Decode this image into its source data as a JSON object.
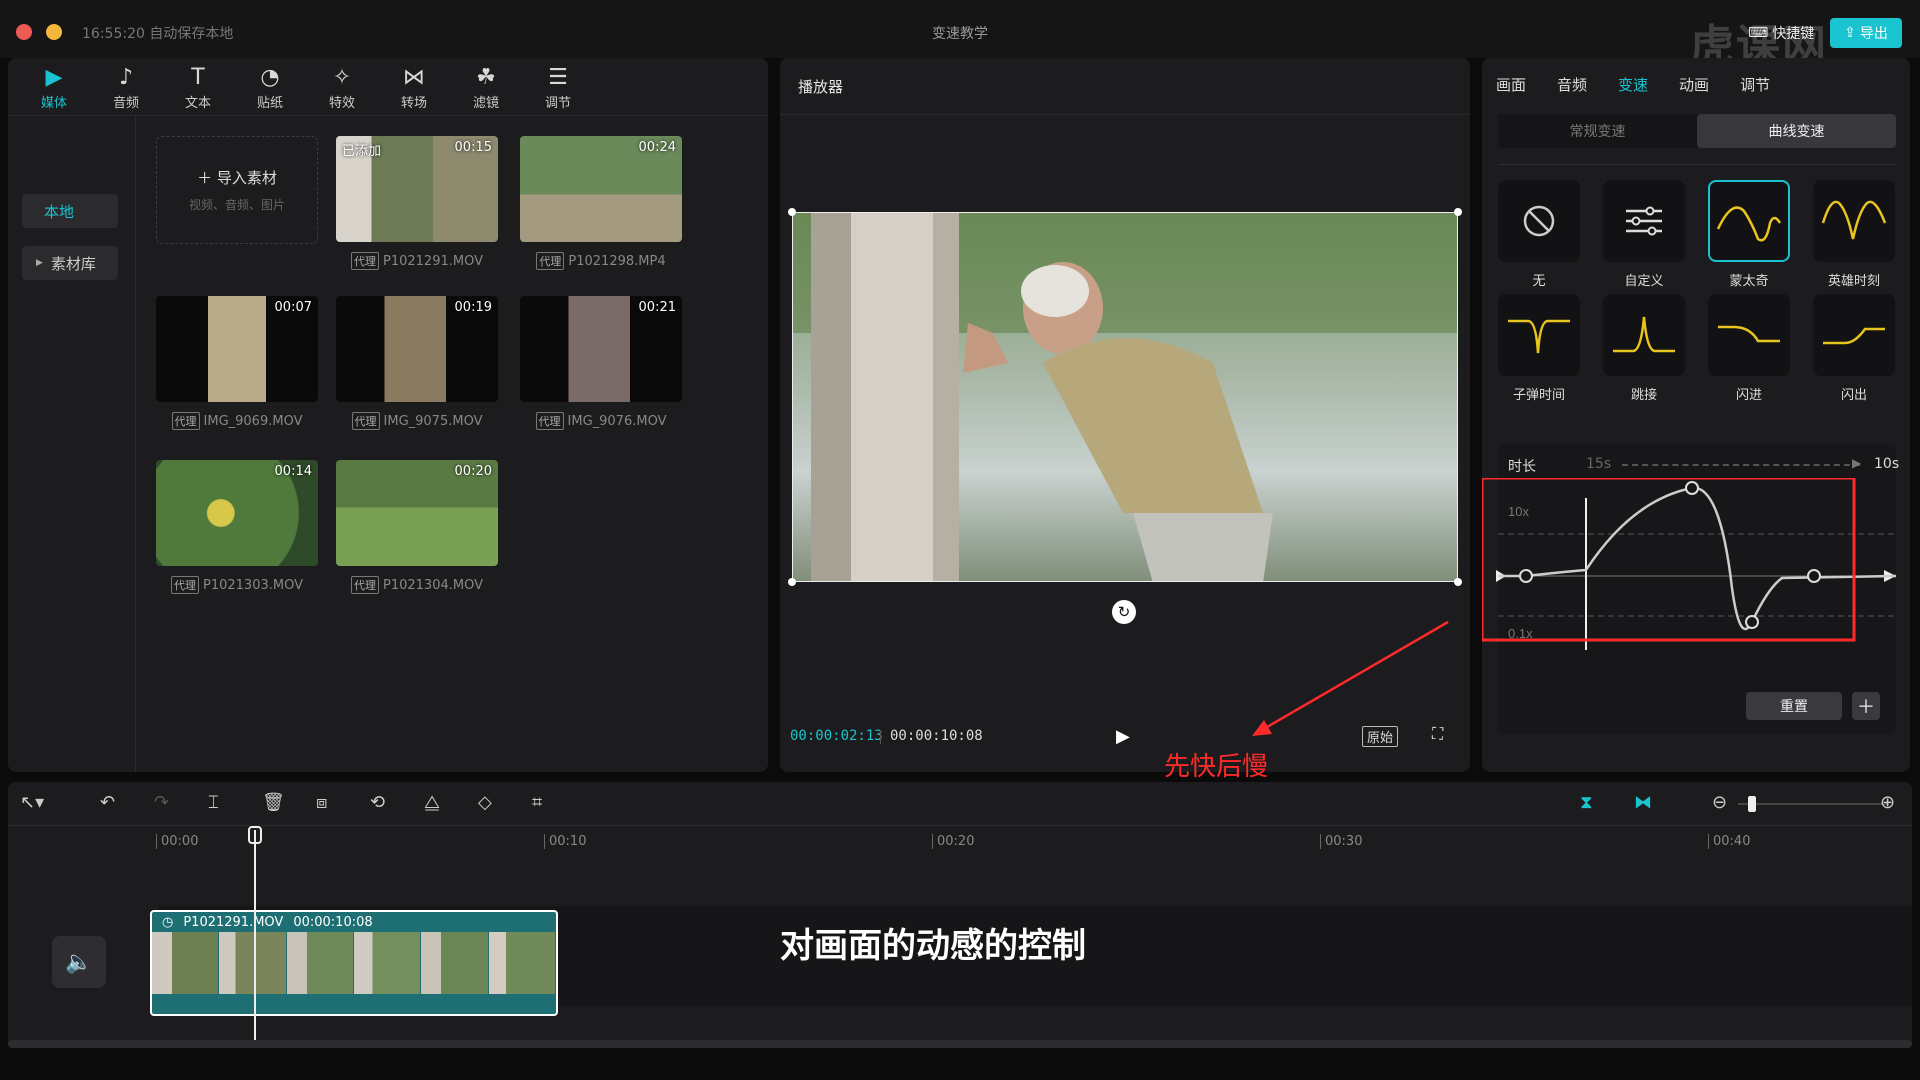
{
  "titlebar": {
    "autosave": "16:55:20 自动保存本地",
    "title": "变速教学",
    "shortcut_label": "快捷键",
    "export_label": "导出",
    "watermark": "虎课网"
  },
  "media": {
    "tabs": [
      {
        "label": "媒体",
        "icon": "media-icon"
      },
      {
        "label": "音频",
        "icon": "audio-icon"
      },
      {
        "label": "文本",
        "icon": "text-icon"
      },
      {
        "label": "贴纸",
        "icon": "sticker-icon"
      },
      {
        "label": "特效",
        "icon": "effects-icon"
      },
      {
        "label": "转场",
        "icon": "transition-icon"
      },
      {
        "label": "滤镜",
        "icon": "filter-icon"
      },
      {
        "label": "调节",
        "icon": "adjust-icon"
      }
    ],
    "side_local": "本地",
    "side_library": "素材库",
    "import_label": "导入素材",
    "import_sub": "视频、音频、图片",
    "proxy_tag": "代理",
    "added_tag": "已添加",
    "clips": [
      {
        "name": "P1021291.MOV",
        "duration": "00:15"
      },
      {
        "name": "P1021298.MP4",
        "duration": "00:24"
      },
      {
        "name": "IMG_9069.MOV",
        "duration": "00:07"
      },
      {
        "name": "IMG_9075.MOV",
        "duration": "00:19"
      },
      {
        "name": "IMG_9076.MOV",
        "duration": "00:21"
      },
      {
        "name": "P1021303.MOV",
        "duration": "00:14"
      },
      {
        "name": "P1021304.MOV",
        "duration": "00:20"
      }
    ]
  },
  "player": {
    "title": "播放器",
    "current_time": "00:00:02:13",
    "total_time": "00:00:10:08",
    "original_label": "原始"
  },
  "annotation": {
    "text": "先快后慢",
    "color": "#ff2a2a"
  },
  "props": {
    "tabs": [
      "画面",
      "音频",
      "变速",
      "动画",
      "调节"
    ],
    "active_tab": "变速",
    "segments": [
      "常规变速",
      "曲线变速"
    ],
    "active_segment": "曲线变速",
    "presets": [
      {
        "label": "无",
        "icon": "none-icon"
      },
      {
        "label": "自定义",
        "icon": "custom-sliders-icon"
      },
      {
        "label": "蒙太奇",
        "icon": "montage-curve-icon"
      },
      {
        "label": "英雄时刻",
        "icon": "hero-moment-curve-icon"
      },
      {
        "label": "子弹时间",
        "icon": "bullet-time-curve-icon"
      },
      {
        "label": "跳接",
        "icon": "jump-cut-curve-icon"
      },
      {
        "label": "闪进",
        "icon": "flash-in-curve-icon"
      },
      {
        "label": "闪出",
        "icon": "flash-out-curve-icon"
      }
    ],
    "selected_preset": "蒙太奇",
    "duration_label": "时长",
    "duration_from": "15s",
    "duration_to": "10s",
    "curve_max_label": "10x",
    "curve_min_label": "0.1x",
    "reset_label": "重置",
    "accent": "#19c3cf"
  },
  "timeline": {
    "ticks": [
      "00:00",
      "00:10",
      "00:20",
      "00:30",
      "00:40"
    ],
    "clip_name": "P1021291.MOV",
    "clip_duration": "00:00:10:08",
    "subtitle": "对画面的动感的控制"
  }
}
